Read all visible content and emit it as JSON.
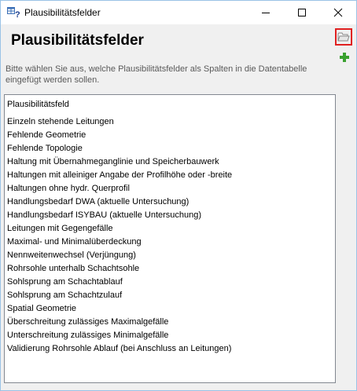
{
  "window": {
    "title": "Plausibilitätsfelder",
    "heading": "Plausibilitätsfelder",
    "description": "Bitte wählen Sie aus, welche Plausibilitätsfelder als Spalten in die Datentabelle eingefügt werden sollen."
  },
  "icons": {
    "app": "table-question-icon",
    "open": "folder-open-icon",
    "add": "green-plus-icon"
  },
  "list": {
    "header": "Plausibilitätsfeld",
    "items": [
      "Einzeln stehende Leitungen",
      "Fehlende Geometrie",
      "Fehlende Topologie",
      "Haltung mit Übernahmeganglinie und Speicherbauwerk",
      "Haltungen mit alleiniger Angabe der Profilhöhe oder -breite",
      "Haltungen ohne hydr. Querprofil",
      "Handlungsbedarf DWA (aktuelle Untersuchung)",
      "Handlungsbedarf ISYBAU (aktuelle Untersuchung)",
      "Leitungen mit Gegengefälle",
      "Maximal- und Minimalüberdeckung",
      "Nennweitenwechsel (Verjüngung)",
      "Rohrsohle unterhalb Schachtsohle",
      "Sohlsprung am Schachtablauf",
      "Sohlsprung am Schachtzulauf",
      "Spatial Geometrie",
      "Überschreitung zulässiges Maximalgefälle",
      "Unterschreitung zulässiges Minimalgefälle",
      "Validierung Rohrsohle Ablauf (bei Anschluss an Leitungen)"
    ]
  },
  "colors": {
    "highlight": "#e02020",
    "add_green": "#3aa12f"
  }
}
